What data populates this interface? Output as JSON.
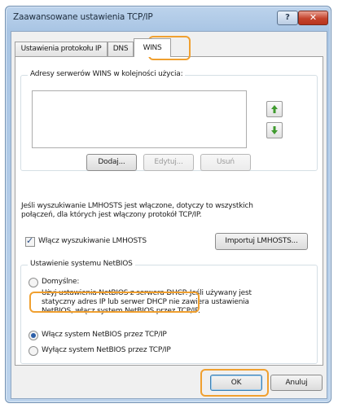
{
  "window": {
    "title": "Zaawansowane ustawienia TCP/IP",
    "help_glyph": "?",
    "close_glyph": "✕"
  },
  "tabs": [
    {
      "label": "Ustawienia protokołu IP"
    },
    {
      "label": "DNS"
    },
    {
      "label": "WINS",
      "active": true
    }
  ],
  "wins_group": {
    "label": "Adresy serwerów WINS w kolejności użycia:",
    "up_icon": "arrow-up-icon",
    "down_icon": "arrow-down-icon",
    "add_label": "Dodaj...",
    "edit_label": "Edytuj...",
    "remove_label": "Usuń"
  },
  "lmhosts": {
    "description_line1": "Jeśli wyszukiwanie LMHOSTS jest włączone, dotyczy to wszystkich",
    "description_line2": "połączeń, dla których jest włączony protokół TCP/IP.",
    "checkbox_label": "Włącz wyszukiwanie LMHOSTS",
    "checked": true,
    "import_label": "Importuj LMHOSTS..."
  },
  "netbios": {
    "group_label": "Ustawienie systemu NetBIOS",
    "default_label": "Domyślne:",
    "default_desc_line1": "Użyj ustawienia NetBIOS z serwera DHCP. Jeśli używany jest",
    "default_desc_line2": "statyczny adres IP lub serwer DHCP nie zawiera ustawienia",
    "default_desc_line3": "NetBIOS, włącz system NetBIOS przez TCP/IP.",
    "enable_label": "Włącz system NetBIOS przez TCP/IP",
    "disable_label": "Wyłącz system NetBIOS przez TCP/IP",
    "selected": "enable"
  },
  "footer": {
    "ok_label": "OK",
    "cancel_label": "Anuluj"
  },
  "colors": {
    "highlight": "#f0a030",
    "arrow": "#3f9a2e"
  }
}
